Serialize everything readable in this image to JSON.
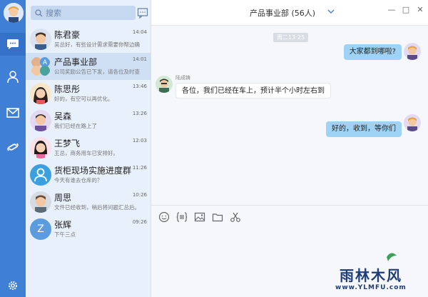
{
  "search": {
    "placeholder": "搜索"
  },
  "conversations": [
    {
      "name": "陈君豪",
      "time": "14:04",
      "preview": "吴总好，有些设计需求需要你帮边确",
      "avatar": "male-face-avatar"
    },
    {
      "name": "产品事业部",
      "time": "14:01",
      "preview": "公司奖励公告已下发，请各位及时查",
      "avatar": "group-avatar-letter-a",
      "selected": true
    },
    {
      "name": "陈思彤",
      "time": "13:46",
      "preview": "好的，有空可以再优化。",
      "avatar": "female-face-avatar"
    },
    {
      "name": "吴森",
      "time": "13:26",
      "preview": "我们已经在路上了",
      "avatar": "male-face-avatar"
    },
    {
      "name": "王梦飞",
      "time": "12:03",
      "preview": "王总，商务用车已安排好。",
      "avatar": "female-face-avatar"
    },
    {
      "name": "货柜现场实施进度群",
      "time": "11:26",
      "preview": "今天有谁去仓库的？",
      "avatar": "group-people-avatar"
    },
    {
      "name": "周思",
      "time": "10:26",
      "preview": "文件已经收到，稍后将问题汇总后。",
      "avatar": "male-face-avatar"
    },
    {
      "name": "张辉",
      "time": "09:26",
      "preview": "下午三点",
      "avatar": "letter-z-avatar",
      "initial": "Z"
    }
  ],
  "chat": {
    "title": "产品事业部 (56人)",
    "timestamp": "周二13:25",
    "messages": [
      {
        "direction": "out",
        "text": "大家都到哪啦?"
      },
      {
        "direction": "in",
        "sender": "陆成铸",
        "text": "各位，我们已经在车上，预计半个小时左右到"
      },
      {
        "direction": "out",
        "text": "好的，收到，等你们"
      }
    ]
  },
  "window_controls": {
    "minimize": "—",
    "maximize": "□",
    "close": "✕"
  },
  "watermark": {
    "brand": "雨林木风",
    "url": "www.YLMFU.com"
  },
  "colors": {
    "rail": "#3f7fd6",
    "list_bg": "#e8f0fb",
    "bubble_out": "#9fd3f5"
  }
}
